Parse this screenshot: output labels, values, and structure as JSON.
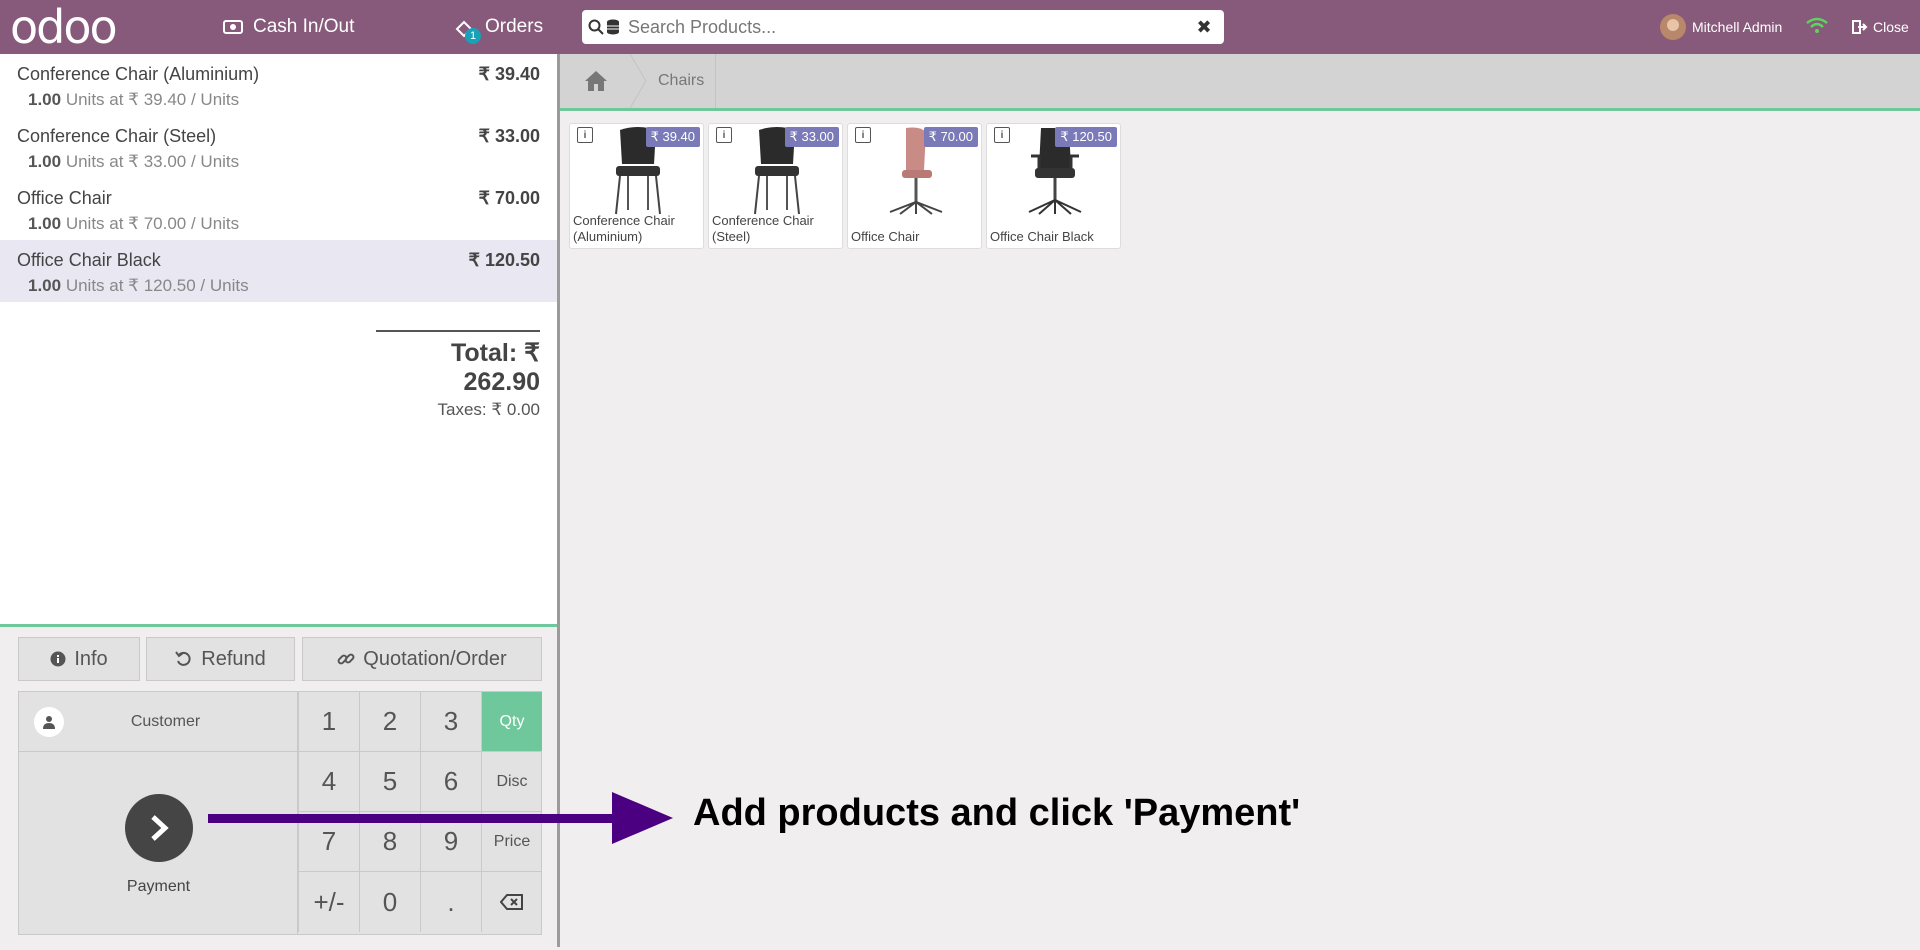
{
  "header": {
    "logo": "odoo",
    "cash_label": "Cash In/Out",
    "orders_label": "Orders",
    "orders_badge": "1",
    "search_placeholder": "Search Products...",
    "user_name": "Mitchell Admin",
    "close_label": "Close"
  },
  "order": {
    "lines": [
      {
        "name": "Conference Chair (Aluminium)",
        "price": "₹ 39.40",
        "qty": "1.00",
        "info": " Units at ₹ 39.40 / Units"
      },
      {
        "name": "Conference Chair (Steel)",
        "price": "₹ 33.00",
        "qty": "1.00",
        "info": " Units at ₹ 33.00 / Units"
      },
      {
        "name": "Office Chair",
        "price": "₹ 70.00",
        "qty": "1.00",
        "info": " Units at ₹ 70.00 / Units"
      },
      {
        "name": "Office Chair Black",
        "price": "₹ 120.50",
        "qty": "1.00",
        "info": " Units at ₹ 120.50 / Units"
      }
    ],
    "total": "Total: ₹ 262.90",
    "taxes": "Taxes: ₹ 0.00"
  },
  "controls": {
    "info_label": "Info",
    "refund_label": "Refund",
    "quotation_label": "Quotation/Order",
    "customer_label": "Customer",
    "payment_label": "Payment",
    "keys": [
      "1",
      "2",
      "3",
      "Qty",
      "4",
      "5",
      "6",
      "Disc",
      "7",
      "8",
      "9",
      "Price",
      "+/-",
      "0",
      "."
    ]
  },
  "breadcrumb": {
    "category": "Chairs"
  },
  "products": [
    {
      "name": "Conference Chair (Aluminium)",
      "price": "₹ 39.40",
      "color": "#2b2b2b"
    },
    {
      "name": "Conference Chair (Steel)",
      "price": "₹ 33.00",
      "color": "#2b2b2b"
    },
    {
      "name": "Office Chair",
      "price": "₹ 70.00",
      "color": "#c98b86"
    },
    {
      "name": "Office Chair Black",
      "price": "₹ 120.50",
      "color": "#2b2b2b"
    }
  ],
  "hint": {
    "text": "Add products and click 'Payment'"
  },
  "colors": {
    "topbar": "#875a7b",
    "accent": "#6ec89b",
    "arrow": "#4b0082",
    "price_badge": "#7a7ab8"
  }
}
